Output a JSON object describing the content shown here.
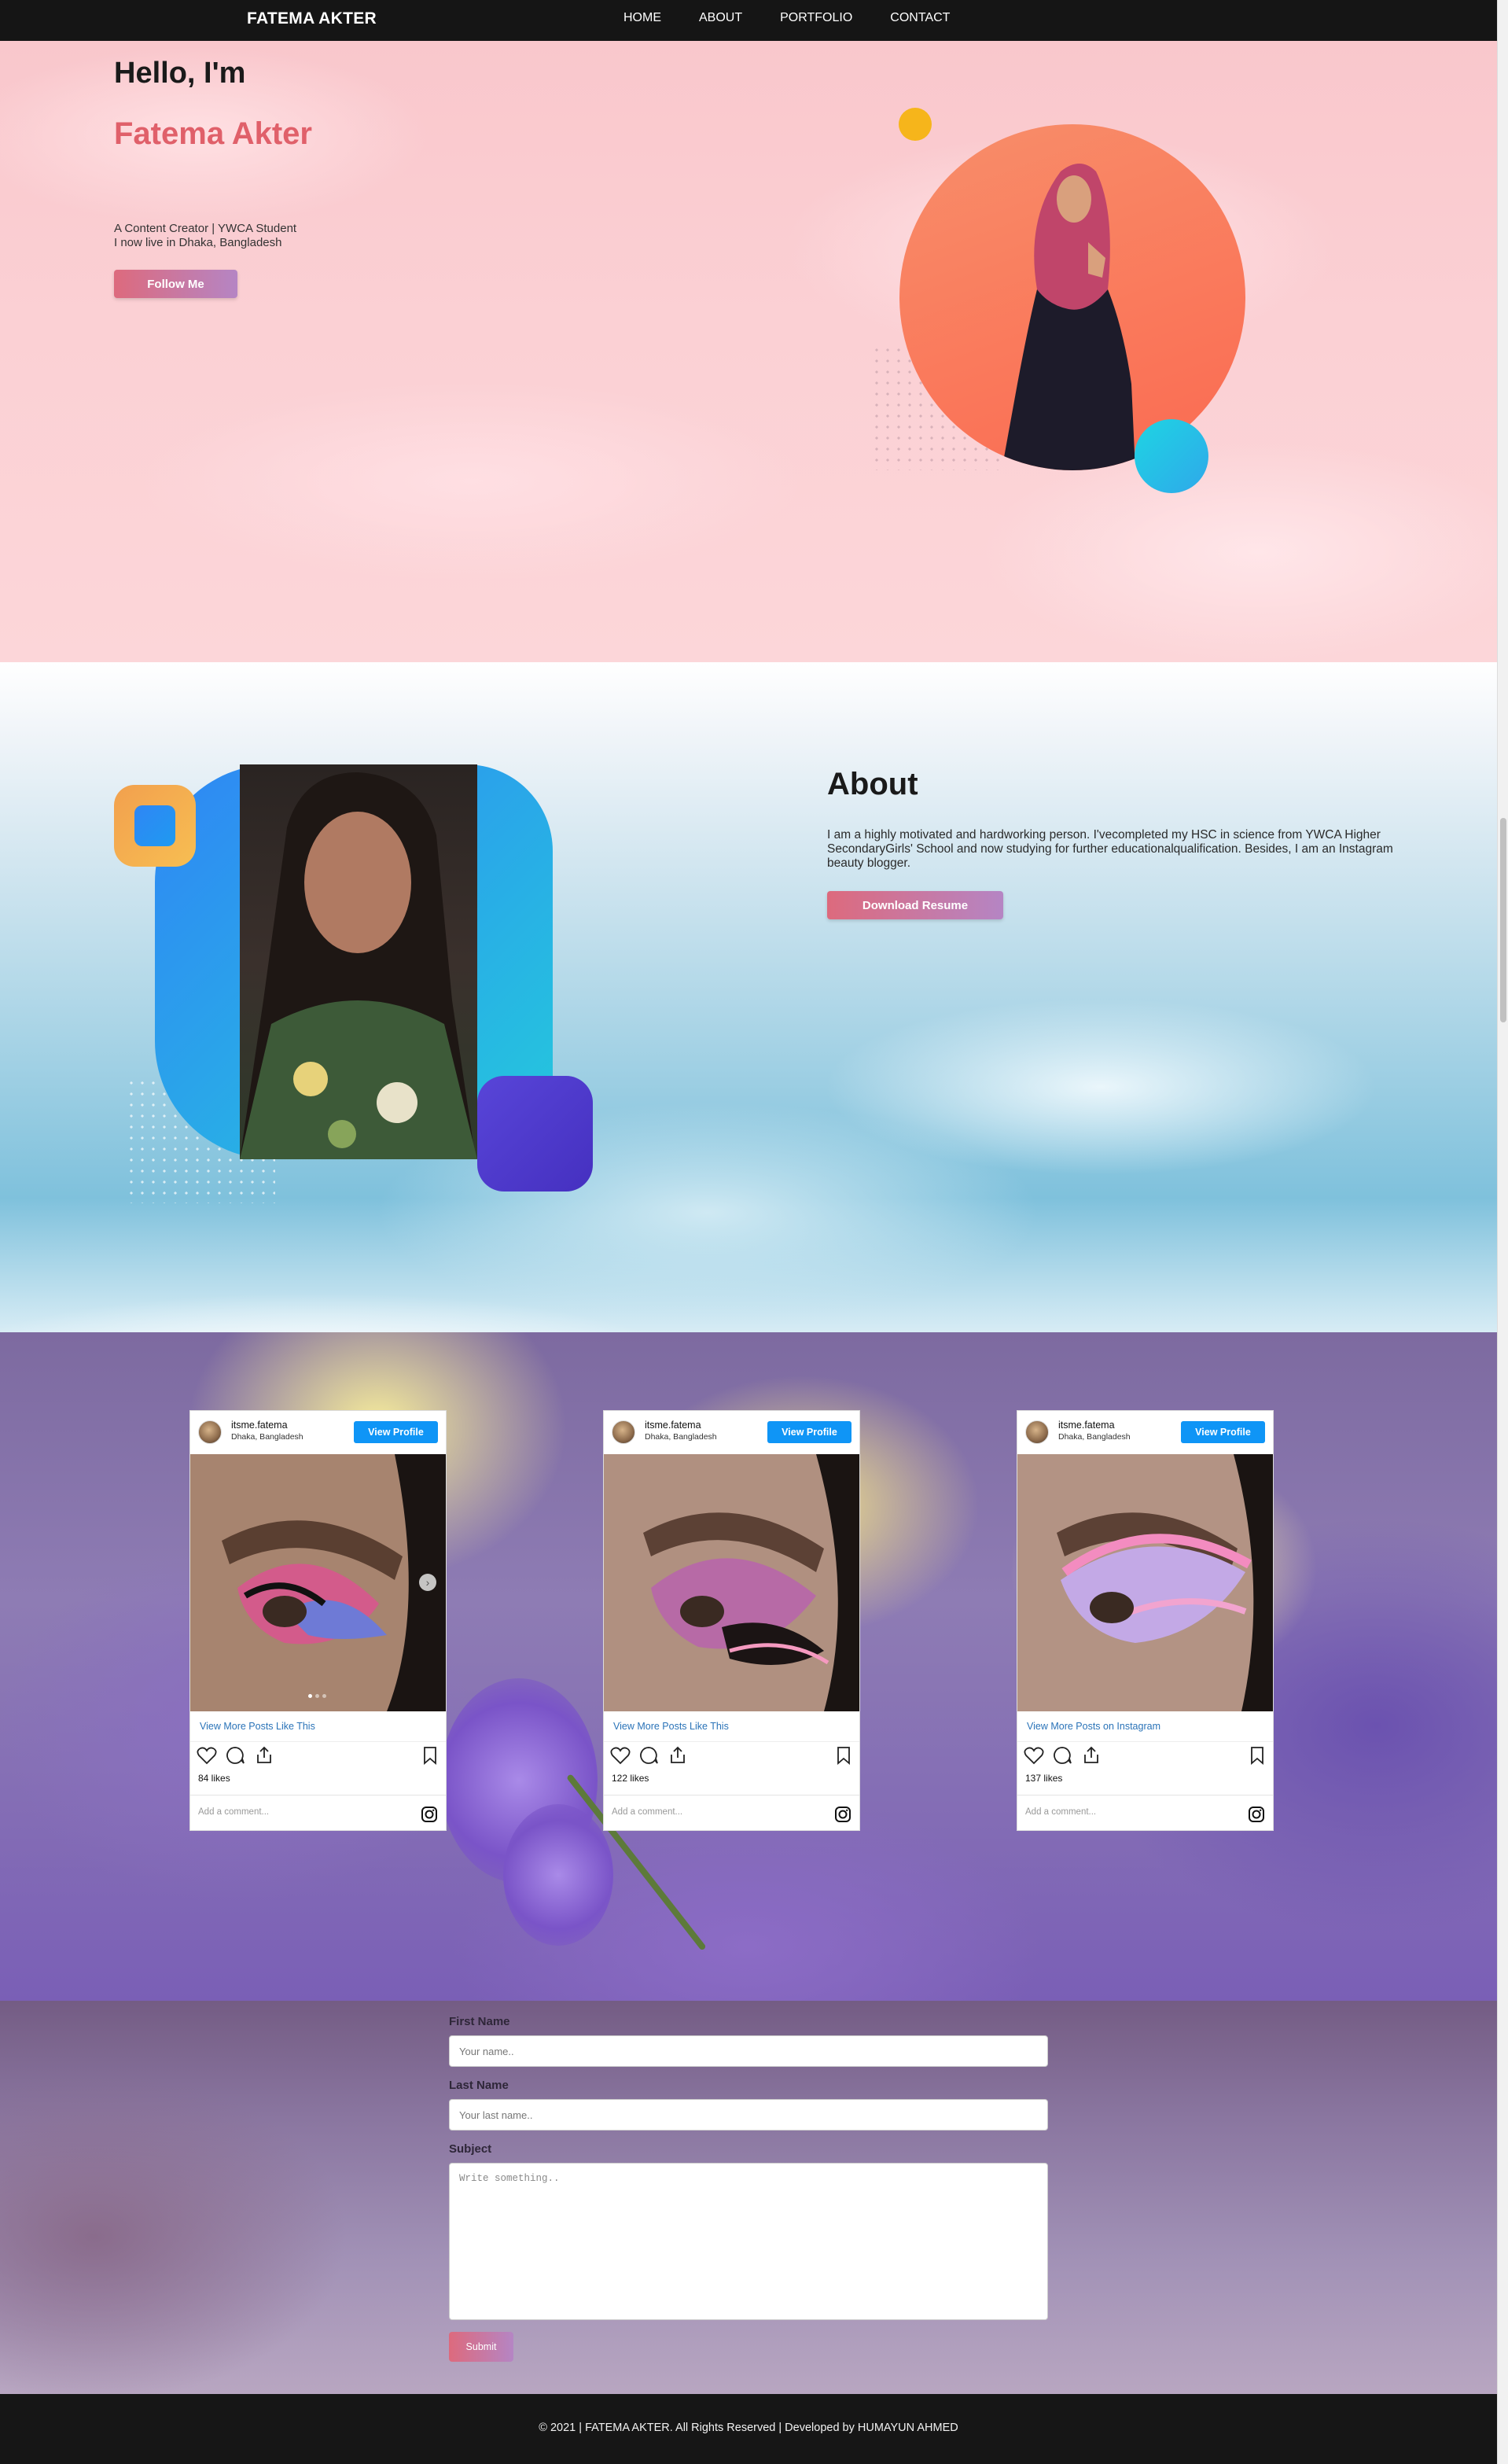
{
  "nav": {
    "brand": "FATEMA AKTER",
    "links": [
      "HOME",
      "ABOUT",
      "PORTFOLIO",
      "CONTACT"
    ]
  },
  "hero": {
    "greeting": "Hello, I'm",
    "name": "Fatema Akter",
    "tagline": "A Content Creator | YWCA Student",
    "location": "I now live in Dhaka, Bangladesh",
    "follow_button": "Follow Me"
  },
  "about": {
    "title": "About",
    "text": "I am a highly motivated and hardworking person. I'vecompleted my HSC in science from YWCA Higher SecondaryGirls' School and now studying for further educationalqualification. Besides, I am an Instagram beauty blogger.",
    "resume_button": "Download Resume"
  },
  "portfolio": {
    "posts": [
      {
        "username": "itsme.fatema",
        "location": "Dhaka, Bangladesh",
        "view_profile": "View Profile",
        "more_link": "View More Posts Like This",
        "likes": "84 likes",
        "comment_placeholder": "Add a comment..."
      },
      {
        "username": "itsme.fatema",
        "location": "Dhaka, Bangladesh",
        "view_profile": "View Profile",
        "more_link": "View More Posts Like This",
        "likes": "122 likes",
        "comment_placeholder": "Add a comment..."
      },
      {
        "username": "itsme.fatema",
        "location": "Dhaka, Bangladesh",
        "view_profile": "View Profile",
        "more_link": "View More Posts on Instagram",
        "likes": "137 likes",
        "comment_placeholder": "Add a comment..."
      }
    ]
  },
  "contact": {
    "first_name_label": "First Name",
    "first_name_placeholder": "Your name..",
    "last_name_label": "Last Name",
    "last_name_placeholder": "Your last name..",
    "subject_label": "Subject",
    "subject_placeholder": "Write something..",
    "submit_label": "Submit"
  },
  "footer": {
    "text": "© 2021 | FATEMA AKTER. All Rights Reserved | Developed by HUMAYUN AHMED"
  },
  "colors": {
    "accent_pink": "#e0606a",
    "button_gradient_start": "#dd6a7d",
    "button_gradient_end": "#b585c4",
    "instagram_blue": "#0f95f6",
    "nav_bg": "#151515"
  }
}
